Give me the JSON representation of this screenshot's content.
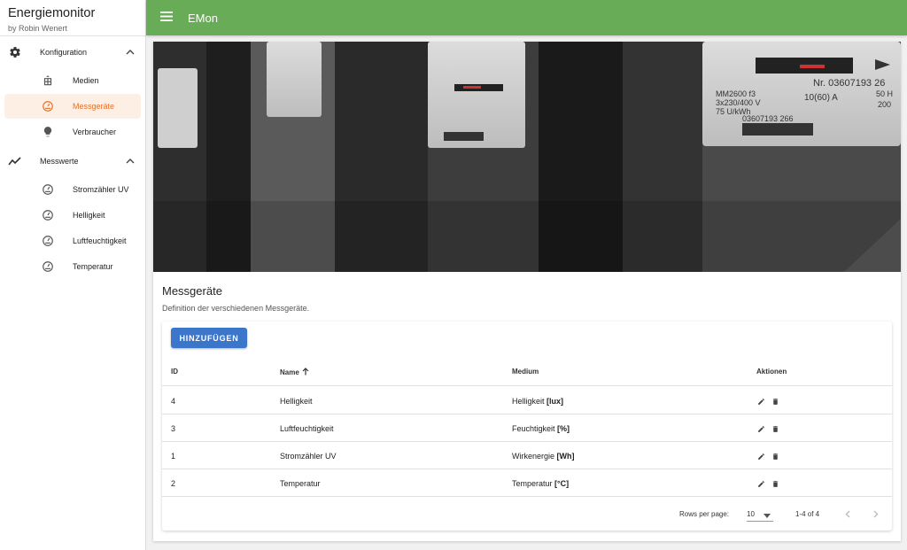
{
  "brand": {
    "title": "Energiemonitor",
    "subtitle": "by Robin Wenert"
  },
  "sidebar": {
    "groups": [
      {
        "label": "Konfiguration",
        "icon": "gear-icon",
        "items": [
          {
            "label": "Medien",
            "icon": "medien-icon"
          },
          {
            "label": "Messgeräte",
            "icon": "gauge-icon",
            "active": true
          },
          {
            "label": "Verbraucher",
            "icon": "lightbulb-icon"
          }
        ]
      },
      {
        "label": "Messwerte",
        "icon": "trend-line-icon",
        "items": [
          {
            "label": "Stromzähler UV",
            "icon": "gauge-icon"
          },
          {
            "label": "Helligkeit",
            "icon": "gauge-icon"
          },
          {
            "label": "Luftfeuchtigkeit",
            "icon": "gauge-icon"
          },
          {
            "label": "Temperatur",
            "icon": "gauge-icon"
          }
        ]
      }
    ]
  },
  "appbar": {
    "title": "EMon"
  },
  "page": {
    "title": "Messgeräte",
    "subtitle": "Definition der verschiedenen Messgeräte.",
    "add_button": "HINZUFÜGEN"
  },
  "table": {
    "columns": {
      "id": "ID",
      "name": "Name",
      "medium": "Medium",
      "actions": "Aktionen"
    },
    "sort": {
      "column": "Name",
      "direction": "ascending"
    },
    "rows": [
      {
        "id": "4",
        "name": "Helligkeit",
        "medium": "Helligkeit",
        "unit": "[lux]"
      },
      {
        "id": "3",
        "name": "Luftfeuchtigkeit",
        "medium": "Feuchtigkeit",
        "unit": "[%]"
      },
      {
        "id": "1",
        "name": "Stromzähler UV",
        "medium": "Wirkenergie",
        "unit": "[Wh]"
      },
      {
        "id": "2",
        "name": "Temperatur",
        "medium": "Temperatur",
        "unit": "[°C]"
      }
    ],
    "pagination": {
      "rows_per_page_label": "Rows per page:",
      "rows_per_page": "10",
      "range": "1-4 of 4"
    }
  },
  "hero_text": {
    "model": "MM2600 f3",
    "voltage": "3x230/400 V",
    "current": "10(60) A",
    "rate": "75 U/kWh",
    "number_top": "Nr. 03607193 26",
    "number_bottom": "03607193 266",
    "frequency": "50 H",
    "extra": "200"
  },
  "colors": {
    "appbar": "#68ac57",
    "accent": "#e8702a",
    "button": "#3c76cb"
  }
}
